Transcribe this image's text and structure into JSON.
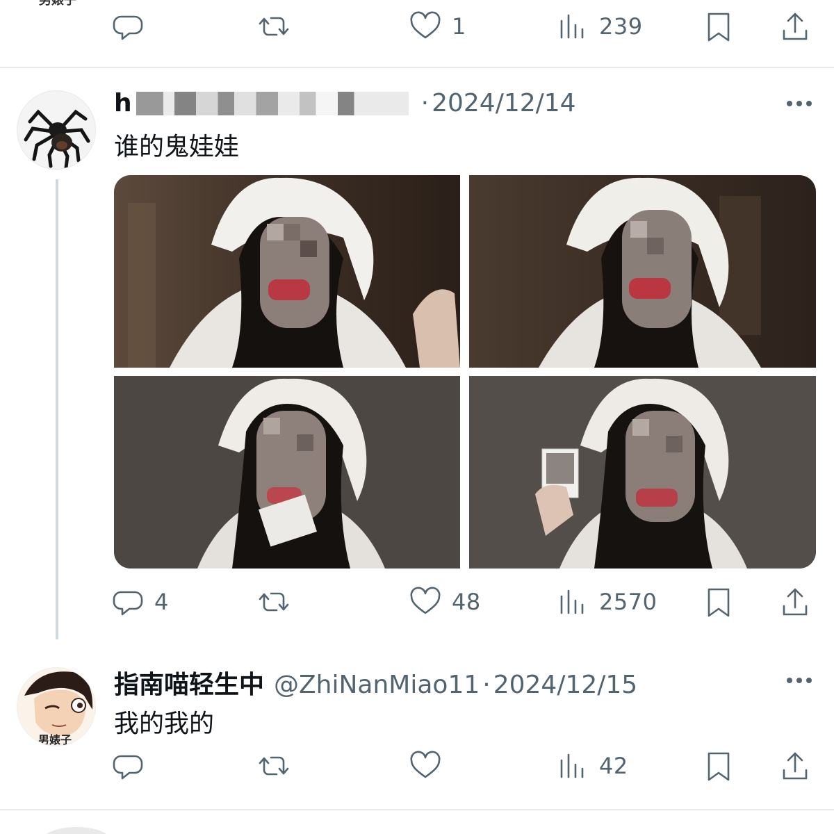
{
  "top_tweet": {
    "author_badge_partial": "男婊子",
    "actions": {
      "reply": "",
      "retweet": "",
      "like": "1",
      "views": "239"
    }
  },
  "main_tweet": {
    "display_name": "h",
    "handle": "",
    "separator": "·",
    "date": "2024/12/14",
    "text": "谁的鬼娃娃",
    "actions": {
      "reply": "4",
      "retweet": "",
      "like": "48",
      "views": "2570"
    },
    "media_count": 4
  },
  "reply_tweet": {
    "display_name": "指南喵轻生中",
    "handle": "@ZhiNanMiao11",
    "separator": "·",
    "date": "2024/12/15",
    "avatar_badge": "男婊子",
    "text": "我的我的",
    "actions": {
      "reply": "",
      "retweet": "",
      "like": "",
      "views": "42"
    }
  },
  "icons": [
    "reply-icon",
    "retweet-icon",
    "like-icon",
    "views-icon",
    "bookmark-icon",
    "share-icon",
    "more-icon"
  ],
  "colors": {
    "muted": "#536471",
    "text": "#0f1419",
    "divider": "#e6eaed",
    "thread_line": "#cfd9de"
  }
}
